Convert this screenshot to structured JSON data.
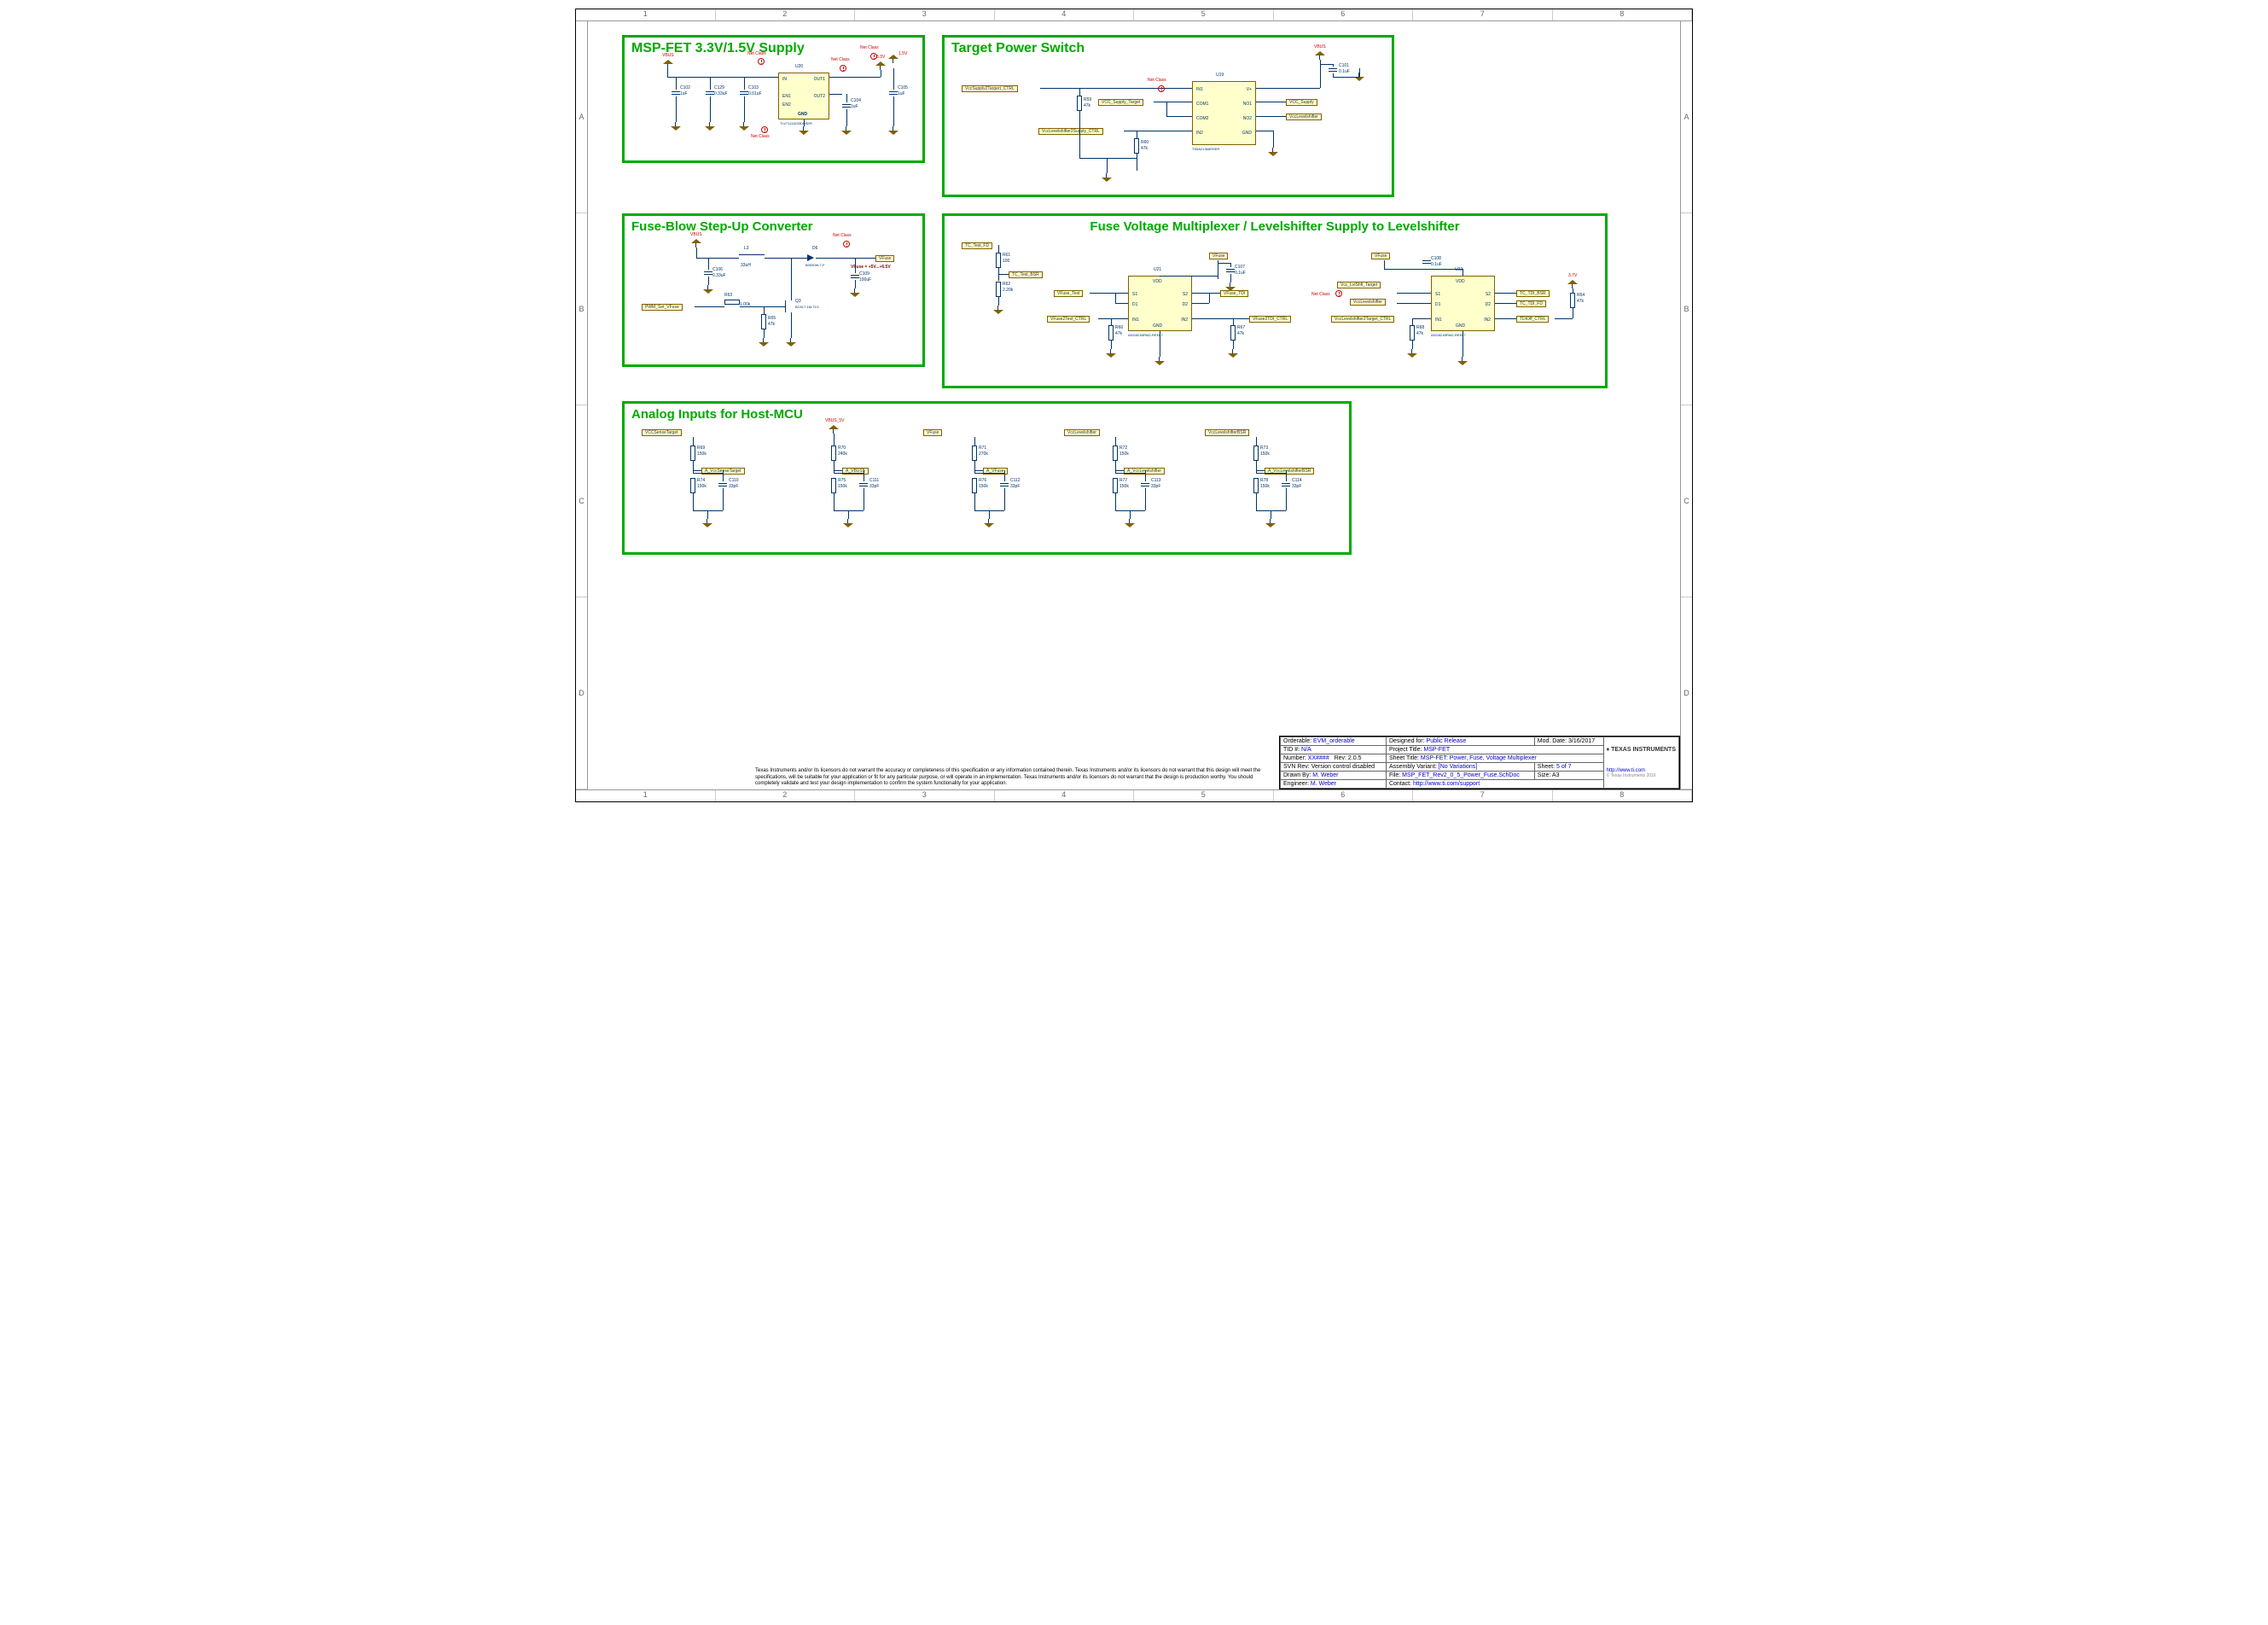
{
  "ruler_cols": [
    "1",
    "2",
    "3",
    "4",
    "5",
    "6",
    "7",
    "8"
  ],
  "ruler_rows": [
    "A",
    "B",
    "C",
    "D"
  ],
  "blocks": {
    "supply": {
      "title": "MSP-FET 3.3V/1.5V Supply"
    },
    "target": {
      "title": "Target Power Switch"
    },
    "fuseblow": {
      "title": "Fuse-Blow Step-Up Converter"
    },
    "fusemux": {
      "title": "Fuse Voltage Multiplexer / Levelshifter Supply to Levelshifter"
    },
    "analog": {
      "title": "Analog Inputs for Host-MCU"
    }
  },
  "supply": {
    "u20": "U20",
    "u20part": "TLV71111533DDSER",
    "gnd_label": "GND",
    "pins": {
      "in": "IN",
      "en1": "EN1",
      "en2": "EN2",
      "out1": "OUT1",
      "out2": "OUT2"
    },
    "c102": "C102",
    "c102v": "1uF",
    "c129": "C129",
    "c129v": "0.33uF",
    "c103": "C103",
    "c103v": "0.01uF",
    "c104": "C104",
    "c104v": "1uF",
    "c105": "C105",
    "c105v": "1uF",
    "vbus": "VBUS",
    "v33": "3.3V",
    "v15": "1.5V",
    "netclass": "Net Class"
  },
  "target": {
    "u19": "U19",
    "u19part": "TS5A21366RSER",
    "pins": {
      "in1": "IN1",
      "com1": "COM1",
      "com2": "COM2",
      "in2": "IN2",
      "vp": "V+",
      "no1": "NO1",
      "no2": "NO2",
      "gnd": "GND"
    },
    "nets": {
      "ctrl1": "VccSupply2Targert_CTRL",
      "vcc_supply_target": "VCC_Supply_Target",
      "ctrl2": "VccLevelshifter2Supply_CTRL",
      "vcc_supply": "VCC_Supply",
      "vccls": "VccLevelshifter"
    },
    "r59": "R59",
    "r59v": "47k",
    "r60": "R60",
    "r60v": "47k",
    "c101": "C101",
    "c101v": "0.1uF",
    "vbus": "VBUS",
    "netclass": "Net Class"
  },
  "fuseblow": {
    "l3": "L3",
    "l3v": "33uH",
    "d6": "D6",
    "d6v": "B0530W-7-F",
    "q3": "Q3",
    "q3v": "BC817-16LT1G",
    "c106": "C106",
    "c106v": "0.33uF",
    "c109": "C109",
    "c109v": "100uF",
    "r63": "R63",
    "r63v": "1.00k",
    "r65": "R65",
    "r65v": "47k",
    "vbus": "VBUS",
    "vfuse": "VFuse",
    "vfuse_range": "VFuse = +5V...+6.5V",
    "pwm": "PWM_Set_VFuse",
    "netclass": "Net Class"
  },
  "fusemux": {
    "u21": "U21",
    "u22": "U22",
    "part": "ADG821BRMZ-REEL7",
    "pins": {
      "vdd": "VDD",
      "s1": "S1",
      "d1": "D1",
      "in1": "IN1",
      "s2": "S2",
      "d2": "D2",
      "in2": "IN2",
      "gnd": "GND"
    },
    "nets": {
      "tc_test_fd": "TC_Test_FD",
      "tc_test_bsr": "TC_Test_BSR",
      "vfuse_test": "VFuse_Test",
      "vfuse2test_ctrl": "VFuse2Test_CTRL",
      "vfuse": "VFuse",
      "vfuse_tdi": "VFuse_TDI",
      "vfuse2tdi_ctrl": "VFuse2TDI_CTRL",
      "vcc_lvlshift_target": "Vcc_LvlShft_Target",
      "vccls": "VccLevelshifter",
      "vccls2target_ctrl": "VccLevelshifter2Target_CTRL",
      "tc_tdi_bsr": "TC_TDI_BSR",
      "tc_tdi_fd": "TC_TDI_FD",
      "tdioff_ctrl": "TDIOff_CTRL"
    },
    "r61": "R61",
    "r61v": "100",
    "r62": "R62",
    "r62v": "2.20k",
    "r66": "R66",
    "r66v": "47k",
    "r67": "R67",
    "r67v": "47k",
    "r68": "R68",
    "r68v": "47k",
    "r64": "R64",
    "r64v": "47k",
    "c107": "C107",
    "c107v": "0.1uF",
    "c108": "C108",
    "c108v": "0.1uF",
    "v37": "3.7V",
    "netclass": "Net Class"
  },
  "analog": {
    "channels": [
      {
        "top_net": "VCCSenseTarget",
        "mid_net": "A_VccSenseTarget",
        "r_top": "R69",
        "r_top_v": "150k",
        "r_bot": "R74",
        "r_bot_v": "150k",
        "c": "C110",
        "c_v": "33pF",
        "vtop": null
      },
      {
        "top_net": null,
        "mid_net": "A_VBUS5",
        "r_top": "R70",
        "r_top_v": "240k",
        "r_bot": "R75",
        "r_bot_v": "150k",
        "c": "C111",
        "c_v": "33pF",
        "vtop": "VBUS_5V"
      },
      {
        "top_net": "VFuse",
        "mid_net": "A_VFuse",
        "r_top": "R71",
        "r_top_v": "270k",
        "r_bot": "R76",
        "r_bot_v": "150k",
        "c": "C112",
        "c_v": "33pF",
        "vtop": null
      },
      {
        "top_net": "VccLevelshifter",
        "mid_net": "A_VccLevelshifter",
        "r_top": "R72",
        "r_top_v": "150k",
        "r_bot": "R77",
        "r_bot_v": "150k",
        "c": "C113",
        "c_v": "33pF",
        "vtop": null
      },
      {
        "top_net": "VccLevelshifterBSR",
        "mid_net": "A_VccLevelshifterBSR",
        "r_top": "R73",
        "r_top_v": "150k",
        "r_bot": "R78",
        "r_bot_v": "150k",
        "c": "C114",
        "c_v": "33pF",
        "vtop": null
      }
    ]
  },
  "titleblock": {
    "orderable_l": "Orderable:",
    "orderable": "EVM_orderable",
    "designed_l": "Designed for:",
    "designed": "Public Release",
    "mod_l": "Mod. Date:",
    "mod": "3/16/2017",
    "tid_l": "TID #:",
    "tid": "N/A",
    "projtitle_l": "Project Title:",
    "projtitle": "MSP-FET",
    "number_l": "Number:",
    "number": "XX####",
    "rev_l": "Rev:",
    "rev": "2.0.5",
    "sheettitle_l": "Sheet Title:",
    "sheettitle": "MSP-FET: Power, Fuse, Voltage Multiplexer",
    "svn_l": "SVN Rev:",
    "svn": "Version control disabled",
    "asm_l": "Assembly Variant:",
    "asm": "[No Variations]",
    "sheet_l": "Sheet:",
    "sheet": "5 of 7",
    "drawn_l": "Drawn By:",
    "drawn": "M. Weber",
    "file_l": "File:",
    "file": "MSP_FET_Rev2_0_5_Power_Fuse.SchDoc",
    "size_l": "Size:",
    "size": "A3",
    "engineer_l": "Engineer:",
    "engineer": "M. Weber",
    "contact_l": "Contact:",
    "contact": "http://www.ti.com/support",
    "url": "http://www.ti.com",
    "company": "TEXAS INSTRUMENTS",
    "copyright": "© Texas Instruments 2016"
  },
  "disclaimer": "Texas Instruments and/or its licensors do not warrant the accuracy or completeness of this specification or any information contained therein. Texas Instruments and/or its licensors do not warrant that this design will meet the specifications, will be suitable for your application or fit for any particular purpose, or will operate in an implementation. Texas Instruments and/or its licensors do not warrant that the design is production worthy. You should completely validate and test your design implementation to confirm the system functionality for your application."
}
